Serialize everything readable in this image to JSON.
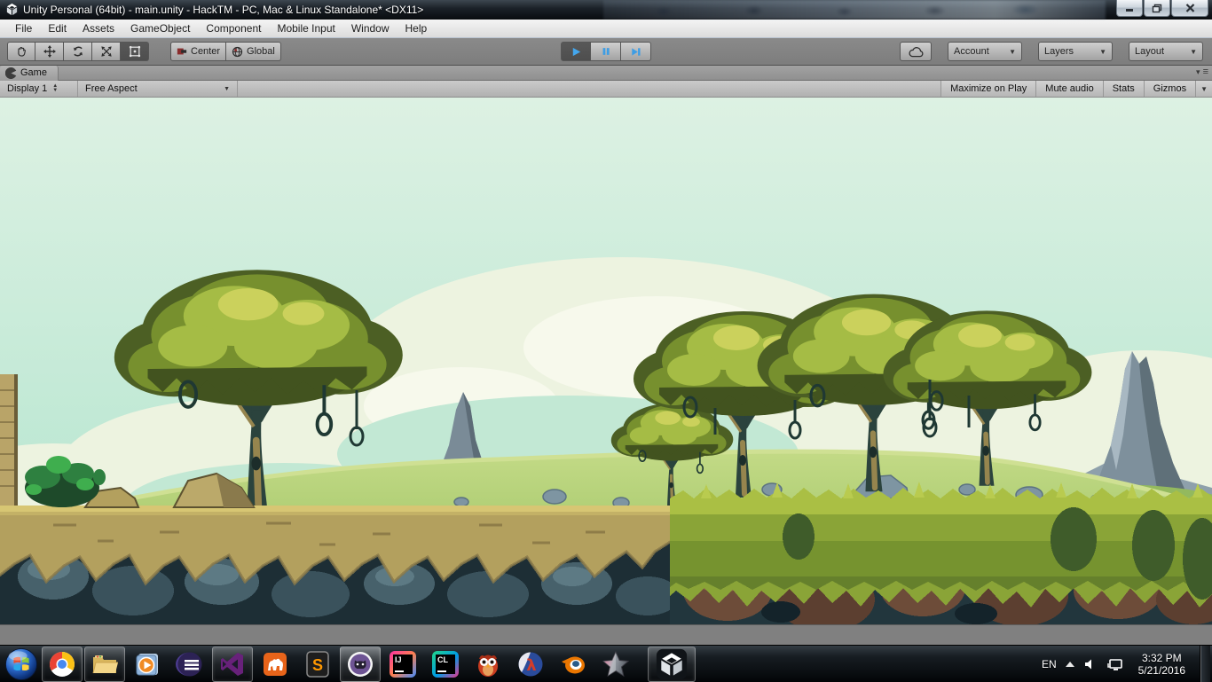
{
  "window": {
    "title": "Unity Personal (64bit) - main.unity - HackTM - PC, Mac & Linux Standalone* <DX11>"
  },
  "menubar": {
    "items": [
      "File",
      "Edit",
      "Assets",
      "GameObject",
      "Component",
      "Mobile Input",
      "Window",
      "Help"
    ]
  },
  "toolbar": {
    "center": "Center",
    "global": "Global",
    "account": "Account",
    "layers": "Layers",
    "layout": "Layout"
  },
  "game_panel": {
    "tab": "Game",
    "display": "Display 1",
    "aspect": "Free Aspect",
    "maximize": "Maximize on Play",
    "mute": "Mute audio",
    "stats": "Stats",
    "gizmos": "Gizmos"
  },
  "scene": {
    "description": "Pixel-art 2D platformer level: leafy trees with vine loops on a dirt platform and a grassy overgrown platform, rolling green hills, gray rock spires and soft pastel clouds on a mint sky.",
    "palette": {
      "sky_top": "#ddf1e3",
      "sky_bottom": "#b0e4cd",
      "cloud": "#edf3e0",
      "cloud_shadow": "#c2e8d4",
      "cloud_deep": "#9cdcc6",
      "hill_top": "#c3da86",
      "hill_bottom": "#8fbb59",
      "dirt": "#b3a05e",
      "dirt_lip": "#d7c673",
      "rock_dark_left": "#1d2e35",
      "rock_dark_right": "#22363d",
      "stone": "#47616b",
      "grass_bright": "#aabf44",
      "grass_mid": "#8aa437",
      "canopy_dark": "#4c5f24",
      "canopy_mid": "#77902e",
      "canopy_light": "#a5bc45",
      "trunk": "#2b433d",
      "mountain": "#7e909c",
      "boulder": "#6d4c39"
    }
  },
  "taskbar": {
    "icons": [
      "start",
      "chrome",
      "explorer",
      "media-player",
      "eclipse",
      "visual-studio",
      "camel",
      "sublime-text",
      "github-desktop",
      "intellij-idea",
      "clion",
      "owl",
      "racket",
      "blender",
      "star",
      "unity"
    ],
    "intellij_label": "IJ",
    "clion_label": "CL",
    "sublime_label": "S",
    "racket_label": "λ",
    "tray": {
      "language": "EN",
      "time": "3:32 PM",
      "date": "5/21/2016"
    }
  }
}
